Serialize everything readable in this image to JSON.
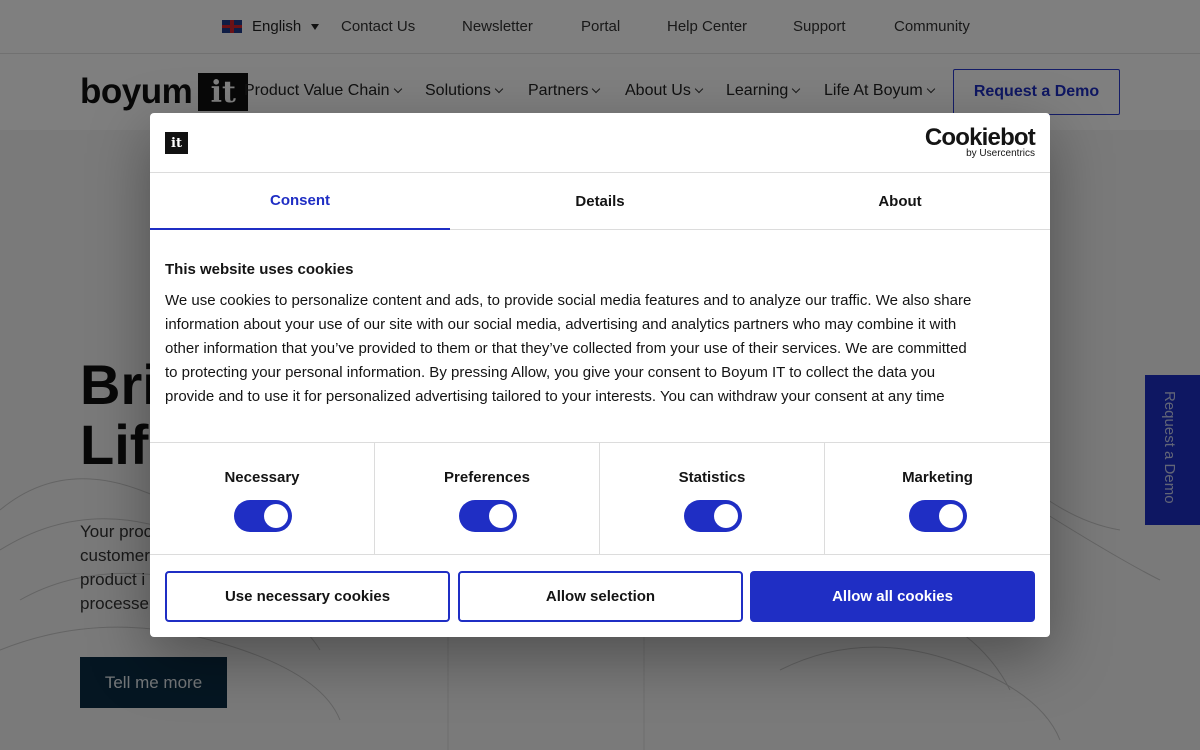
{
  "topbar": {
    "language": "English",
    "links": [
      "Contact Us",
      "Newsletter",
      "Portal",
      "Help Center",
      "Support",
      "Community"
    ]
  },
  "nav": {
    "logo_word": "boyum",
    "logo_mark": "it",
    "items": [
      "Product Value Chain",
      "Solutions",
      "Partners",
      "About Us",
      "Learning",
      "Life At Boyum"
    ],
    "demo_button": "Request a Demo"
  },
  "hero": {
    "title_line1": "Bri",
    "title_line2": "Life",
    "text_lines": [
      "Your proc",
      "customer",
      "product i",
      "processe"
    ],
    "cta": "Tell me more",
    "side_tab": "Request a Demo"
  },
  "dialog": {
    "logo_mark": "it",
    "brand_name": "Cookiebot",
    "brand_sub": "by Usercentrics",
    "tabs": [
      "Consent",
      "Details",
      "About"
    ],
    "heading": "This website uses cookies",
    "body_lines": [
      "We use cookies to personalize content and ads, to provide social media features and to analyze our traffic. We also share",
      "information about your use of our site with our social media, advertising and analytics partners who may combine it with",
      "other information that you’ve provided to them or that they’ve collected from your use of their services. We are committed",
      "to protecting your personal information. By pressing Allow, you give your consent to Boyum IT to collect the data you",
      "provide and to use it for personalized advertising tailored to your interests. You can withdraw your consent at any time"
    ],
    "toggles": [
      {
        "label": "Necessary",
        "on": true
      },
      {
        "label": "Preferences",
        "on": true
      },
      {
        "label": "Statistics",
        "on": true
      },
      {
        "label": "Marketing",
        "on": true
      }
    ],
    "buttons": {
      "necessary": "Use necessary cookies",
      "selection": "Allow selection",
      "all": "Allow all cookies"
    }
  },
  "colors": {
    "accent": "#1f2ec4",
    "overlay": "rgba(0,0,0,0.5)",
    "cta_dark": "#0a2c45"
  }
}
